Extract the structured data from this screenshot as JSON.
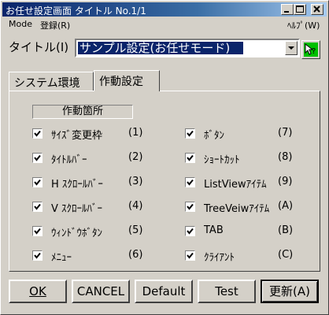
{
  "window": {
    "title": "お任せ設定画面 タイトル No.1/1"
  },
  "menu": {
    "mode": "Mode",
    "register": "登録(R)",
    "help": "ﾍﾙﾌﾟ(W)"
  },
  "title_row": {
    "label": "タイトル(I)",
    "value": "サンプル設定(お任せモード)"
  },
  "tabs": [
    {
      "label": "システム環境",
      "active": false
    },
    {
      "label": "作動設定",
      "active": true
    }
  ],
  "section": {
    "label": "作動箇所"
  },
  "options_left": [
    {
      "label": "ｻｲｽﾞ変更枠",
      "key": "(1)",
      "checked": true
    },
    {
      "label": "ﾀｲﾄﾙﾊﾞｰ",
      "key": "(2)",
      "checked": true
    },
    {
      "label": "H ｽｸﾛｰﾙﾊﾞｰ",
      "key": "(3)",
      "checked": true
    },
    {
      "label": "V ｽｸﾛｰﾙﾊﾞｰ",
      "key": "(4)",
      "checked": true
    },
    {
      "label": "ｳｨﾝﾄﾞｳﾎﾞﾀﾝ",
      "key": "(5)",
      "checked": true
    },
    {
      "label": "ﾒﾆｭｰ",
      "key": "(6)",
      "checked": true
    }
  ],
  "options_right": [
    {
      "label": "ﾎﾞﾀﾝ",
      "key": "(7)",
      "checked": true
    },
    {
      "label": "ｼｮｰﾄｶｯﾄ",
      "key": "(8)",
      "checked": true
    },
    {
      "label": "ListViewｱｲﾃﾑ",
      "key": "(9)",
      "checked": true
    },
    {
      "label": "TreeVeiwｱｲﾃﾑ",
      "key": "(A)",
      "checked": true
    },
    {
      "label": "TAB",
      "key": "(B)",
      "checked": true
    },
    {
      "label": "ｸﾗｲｱﾝﾄ",
      "key": "(C)",
      "checked": true
    }
  ],
  "buttons": {
    "ok": "OK",
    "cancel": "CANCEL",
    "default": "Default",
    "test": "Test",
    "update": "更新(A)"
  }
}
